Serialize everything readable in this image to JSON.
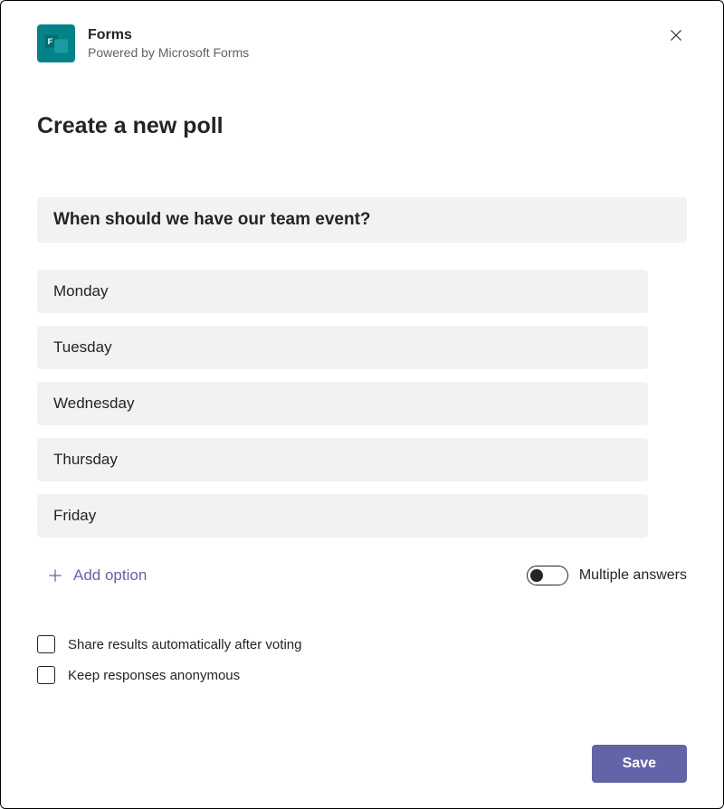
{
  "header": {
    "app_title": "Forms",
    "subtitle": "Powered by Microsoft Forms",
    "close_icon": "close"
  },
  "page_heading": "Create a new poll",
  "question": {
    "value": "When should we have our team event?"
  },
  "options": [
    {
      "value": "Monday"
    },
    {
      "value": "Tuesday"
    },
    {
      "value": "Wednesday"
    },
    {
      "value": "Thursday"
    },
    {
      "value": "Friday"
    }
  ],
  "add_option_label": "Add option",
  "multiple_answers": {
    "label": "Multiple answers",
    "enabled": false
  },
  "checkboxes": {
    "share_results": {
      "label": "Share results automatically after voting",
      "checked": false
    },
    "anonymous": {
      "label": "Keep responses anonymous",
      "checked": false
    }
  },
  "save_label": "Save",
  "colors": {
    "accent": "#6264a7",
    "app_icon": "#038387",
    "field_bg": "#f3f2f1"
  }
}
